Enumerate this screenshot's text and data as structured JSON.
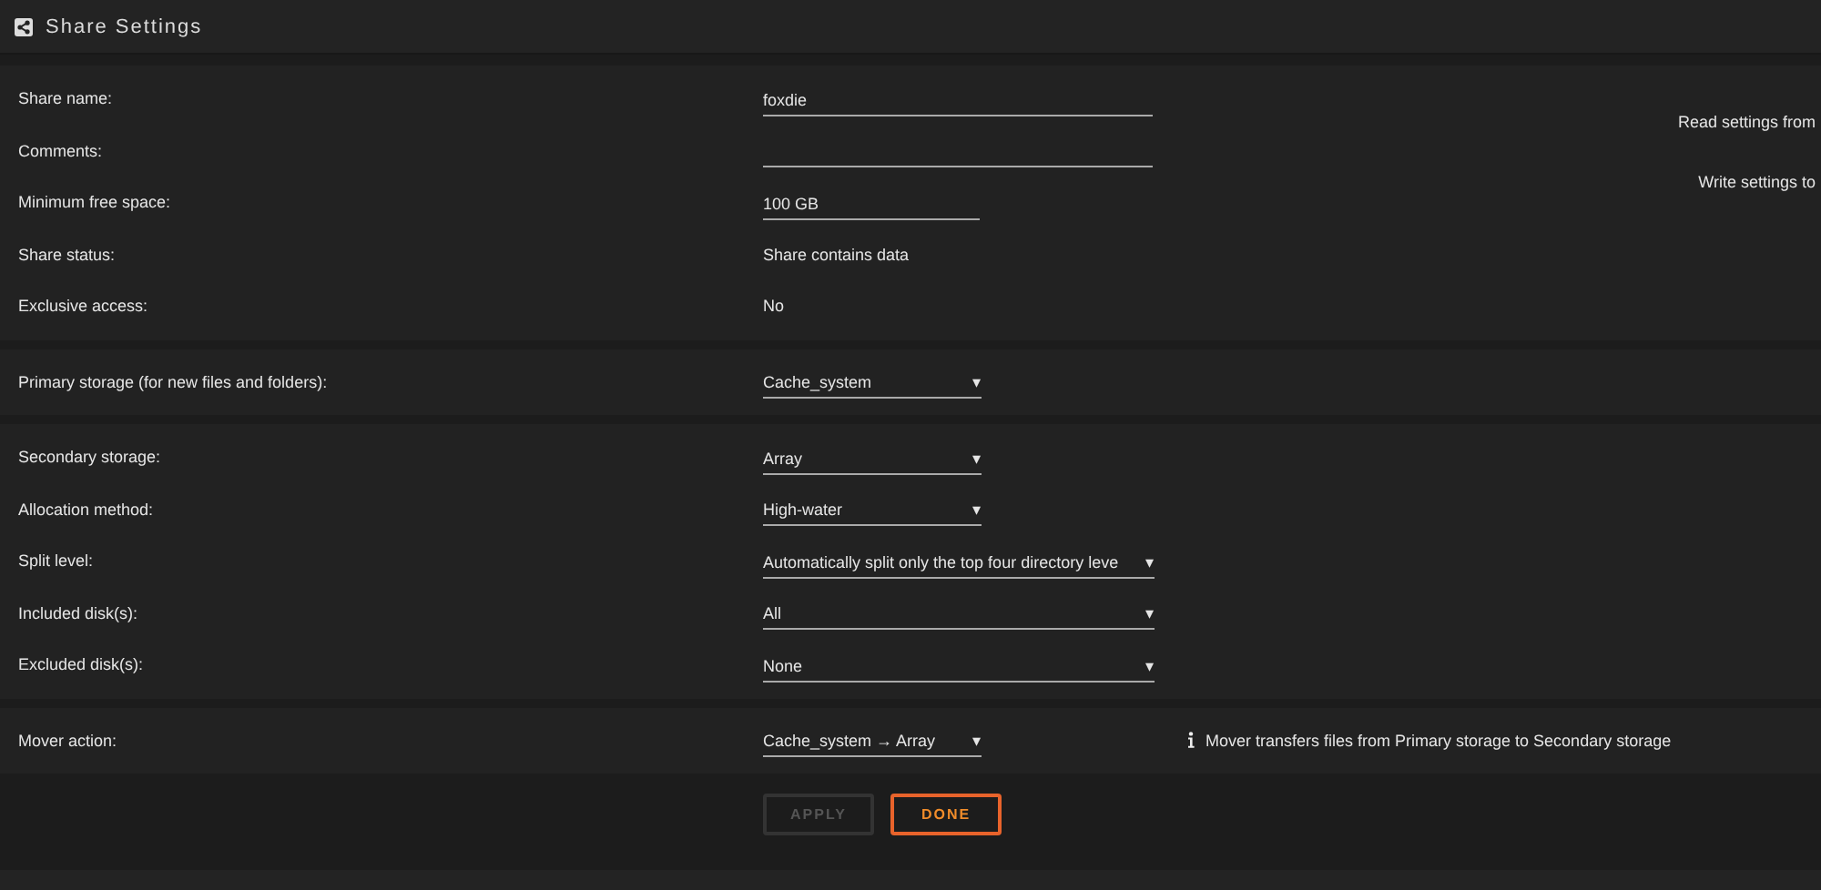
{
  "header": {
    "title": "Share Settings"
  },
  "side_labels": [
    "Read settings from",
    "Write settings to"
  ],
  "sections": [
    {
      "rows": [
        {
          "label": "Share name:",
          "kind": "input",
          "value": "foxdie"
        },
        {
          "label": "Comments:",
          "kind": "input"
        },
        {
          "label": "Minimum free space:",
          "kind": "short",
          "value": "100 GB"
        },
        {
          "label": "Share status:",
          "kind": "text",
          "value": "Share contains data"
        },
        {
          "label": "Exclusive access:",
          "kind": "text",
          "value": "No"
        }
      ]
    },
    {
      "rows": [
        {
          "label": "Primary storage (for new files and folders):",
          "kind": "select",
          "value": "Cache_system",
          "caret": "▾"
        }
      ]
    },
    {
      "rows": [
        {
          "label": "Secondary storage:",
          "kind": "select",
          "value": "Array",
          "caret": "▾"
        },
        {
          "label": "Allocation method:",
          "kind": "select",
          "value": "High-water",
          "caret": "▾"
        },
        {
          "label": "Split level:",
          "kind": "wide",
          "value": "Automatically split only the top four directory leve",
          "caret": "▾"
        },
        {
          "label": "Included disk(s):",
          "kind": "wide",
          "value": "All",
          "caret": "▾"
        },
        {
          "label": "Excluded disk(s):",
          "kind": "wide",
          "value": "None",
          "caret": "▾"
        }
      ]
    },
    {
      "rows": [
        {
          "label": "Mover action:",
          "kind": "select",
          "value": "Cache_system → Array",
          "caret": "▾",
          "note": "Mover transfers files from Primary storage to Secondary storage"
        }
      ]
    }
  ],
  "buttons": [
    {
      "label": "APPLY",
      "disabled": true
    },
    {
      "label": "DONE",
      "disabled": false
    }
  ]
}
